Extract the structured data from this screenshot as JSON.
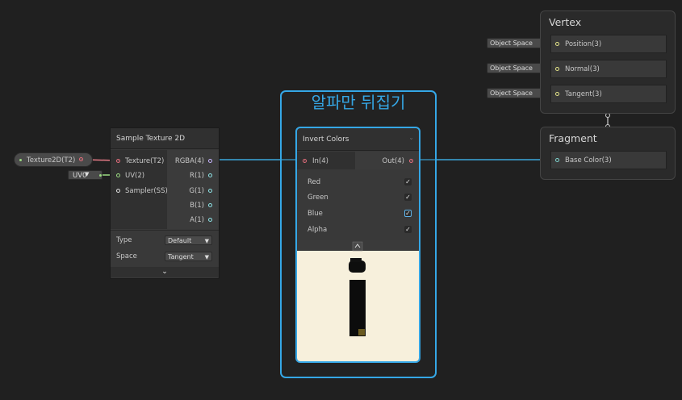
{
  "group": {
    "title": "알파만 뒤집기"
  },
  "property_node": {
    "label": "Texture2D(T2)"
  },
  "uv_field": {
    "value": "UV0"
  },
  "sample_texture": {
    "title": "Sample Texture 2D",
    "inputs": [
      "Texture(T2)",
      "UV(2)",
      "Sampler(SS)"
    ],
    "outputs": [
      "RGBA(4)",
      "R(1)",
      "G(1)",
      "B(1)",
      "A(1)"
    ],
    "type_label": "Type",
    "type_value": "Default",
    "space_label": "Space",
    "space_value": "Tangent"
  },
  "invert_colors": {
    "title": "Invert Colors",
    "input": "In(4)",
    "output": "Out(4)",
    "channels": [
      {
        "label": "Red",
        "checked": true
      },
      {
        "label": "Green",
        "checked": true
      },
      {
        "label": "Blue",
        "checked": true
      },
      {
        "label": "Alpha",
        "checked": true
      }
    ],
    "check_glyph": "✓"
  },
  "vertex": {
    "title": "Vertex",
    "blocks": [
      "Position(3)",
      "Normal(3)",
      "Tangent(3)"
    ],
    "space_tags": [
      "Object Space",
      "Object Space",
      "Object Space"
    ]
  },
  "fragment": {
    "title": "Fragment",
    "blocks": [
      "Base Color(3)"
    ]
  },
  "colors": {
    "accent": "#35a7e6",
    "preview_bg": "#f7f0dc",
    "wire": "#3aa7dc",
    "texture_wire": "#e77b87",
    "uv_wire": "#9bda82"
  }
}
